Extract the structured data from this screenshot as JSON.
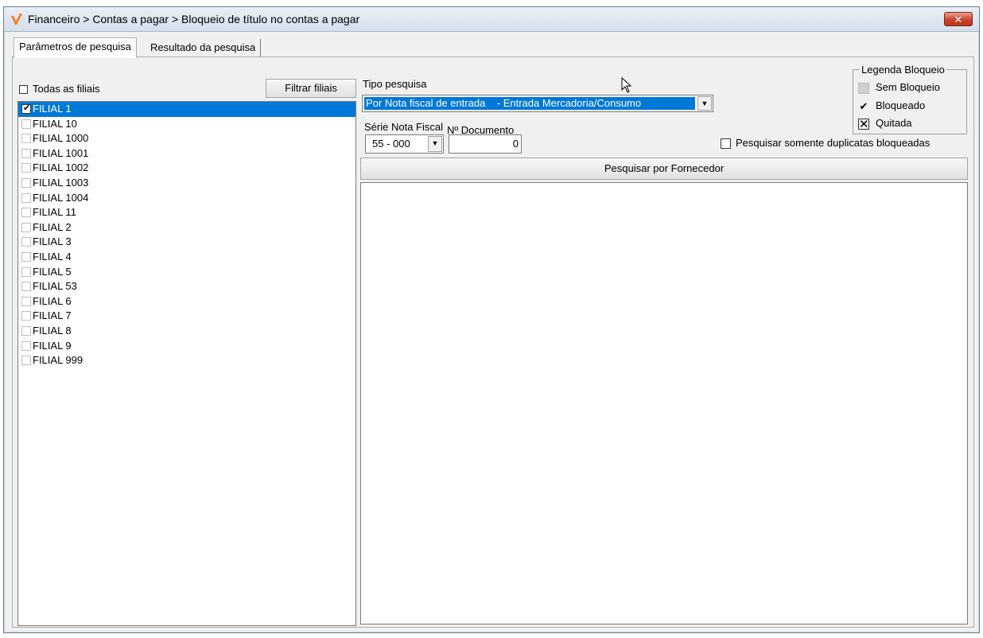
{
  "window": {
    "title": "Financeiro > Contas a pagar > Bloqueio de título no contas a pagar",
    "close_label": "✕",
    "accent": "#ff7a1a"
  },
  "tabs": [
    {
      "label": "Parâmetros de pesquisa",
      "active": true
    },
    {
      "label": "Resultado da pesquisa",
      "active": false
    }
  ],
  "filiais": {
    "todas_label": "Todas as filiais",
    "filtrar_label": "Filtrar filiais",
    "items": [
      {
        "label": "FILIAL 1",
        "checked": true,
        "selected": true
      },
      {
        "label": "FILIAL 10",
        "checked": false
      },
      {
        "label": "FILIAL 1000",
        "checked": false
      },
      {
        "label": "FILIAL 1001",
        "checked": false
      },
      {
        "label": "FILIAL 1002",
        "checked": false
      },
      {
        "label": "FILIAL 1003",
        "checked": false
      },
      {
        "label": "FILIAL 1004",
        "checked": false
      },
      {
        "label": "FILIAL 11",
        "checked": false
      },
      {
        "label": "FILIAL 2",
        "checked": false
      },
      {
        "label": "FILIAL 3",
        "checked": false
      },
      {
        "label": "FILIAL 4",
        "checked": false
      },
      {
        "label": "FILIAL 5",
        "checked": false
      },
      {
        "label": "FILIAL 53",
        "checked": false
      },
      {
        "label": "FILIAL 6",
        "checked": false
      },
      {
        "label": "FILIAL 7",
        "checked": false
      },
      {
        "label": "FILIAL 8",
        "checked": false
      },
      {
        "label": "FILIAL 9",
        "checked": false
      },
      {
        "label": "FILIAL 999",
        "checked": false
      }
    ]
  },
  "search": {
    "tipo_label": "Tipo pesquisa",
    "tipo_value": "Por Nota fiscal de entrada    - Entrada Mercadoria/Consumo",
    "serie_label": "Série Nota Fiscal",
    "serie_value": "55 - 000",
    "numdoc_label": "Nº Documento",
    "numdoc_value": "0",
    "only_blocked_label": "Pesquisar somente duplicatas bloqueadas",
    "fornecedor_button": "Pesquisar por Fornecedor"
  },
  "legend": {
    "title": "Legenda Bloqueio",
    "items": [
      {
        "label": "Sem Bloqueio",
        "icon": "gray-square-icon"
      },
      {
        "label": "Bloqueado",
        "icon": "check-icon"
      },
      {
        "label": "Quitada",
        "icon": "x-icon"
      }
    ]
  }
}
